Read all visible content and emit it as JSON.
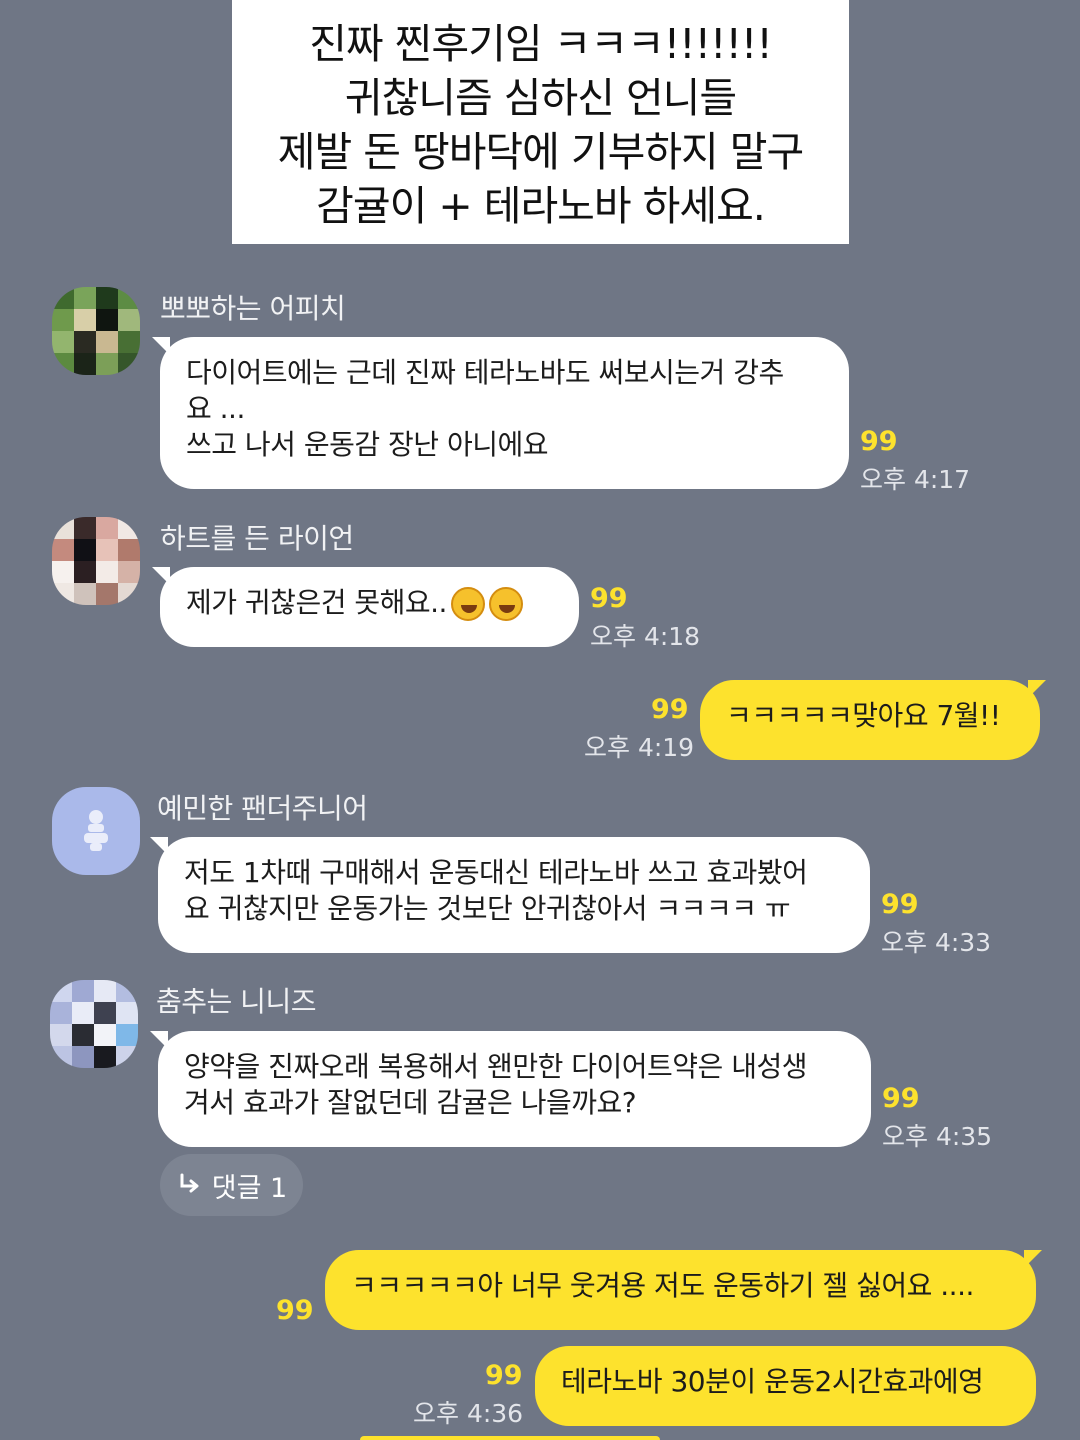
{
  "banner": {
    "lines": [
      "진짜 찐후기임 ㅋㅋㅋ!!!!!!!",
      "귀찮니즘 심하신 언니들",
      "제발 돈 땅바닥에 기부하지 말구",
      "감귤이 + 테라노바 하세요."
    ]
  },
  "messages": [
    {
      "sender": "뽀뽀하는 어피치",
      "lines": [
        "다이어트에는 근데 진짜 테라노바도 써보시는거 강추",
        "요 ...",
        "쓰고 나서 운동감 장난 아니에요"
      ],
      "count": "99",
      "time": "오후 4:17"
    },
    {
      "sender": "하트를 든 라이언",
      "lines": [
        "제가 귀찮은건 못해요.."
      ],
      "emoji": [
        "rolling-laughing-emoji",
        "rolling-laughing-emoji"
      ],
      "count": "99",
      "time": "오후 4:18"
    },
    {
      "mine": true,
      "lines": [
        "ㅋㅋㅋㅋㅋ맞아요 7월!!"
      ],
      "count": "99",
      "time": "오후 4:19"
    },
    {
      "sender": "예민한 팬더주니어",
      "lines": [
        "저도 1차때 구매해서 운동대신 테라노바 쓰고 효과봤어",
        "요 귀찮지만 운동가는 것보단 안귀찮아서 ㅋㅋㅋㅋ ㅠ"
      ],
      "count": "99",
      "time": "오후 4:33"
    },
    {
      "sender": "춤추는 니니즈",
      "lines": [
        "양약을 진짜오래 복용해서 왠만한 다이어트약은 내성생",
        "겨서 효과가 잘없던데 감귤은 나을까요?"
      ],
      "count": "99",
      "time": "오후 4:35",
      "reply_label": "댓글 1"
    },
    {
      "mine": true,
      "lines": [
        "ㅋㅋㅋㅋㅋ아 너무 웃겨용 저도 운동하기 젤 싫어요 ...."
      ],
      "count": "99"
    },
    {
      "mine": true,
      "lines": [
        "테라노바 30분이 운동2시간효과에영"
      ],
      "count": "99",
      "time": "오후 4:36"
    }
  ],
  "colors": {
    "background": "#6f7685",
    "my_bubble": "#fde22d",
    "other_bubble": "#ffffff",
    "unread_count": "#fde22d"
  }
}
